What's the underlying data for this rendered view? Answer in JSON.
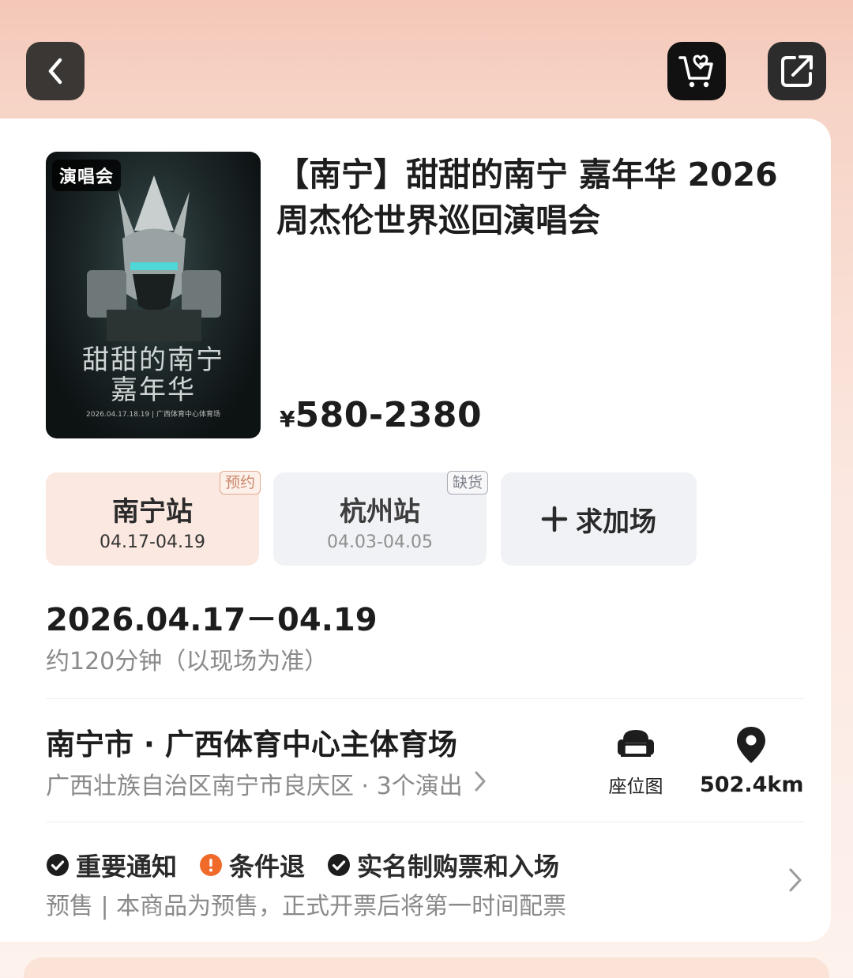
{
  "header": {
    "back_icon": "chevron-left-icon",
    "wishlist_icon": "cart-heart-icon",
    "share_icon": "share-icon"
  },
  "poster": {
    "tag": "演唱会",
    "title_line1": "甜甜的南宁",
    "title_line2": "嘉年华",
    "subtitle": "2026.04.17.18.19 | 广西体育中心体育场"
  },
  "event": {
    "title": "【南宁】甜甜的南宁 嘉年华 2026 周杰伦世界巡回演唱会",
    "price_symbol": "¥",
    "price_range": "580-2380"
  },
  "sessions": [
    {
      "name": "南宁站",
      "date": "04.17-04.19",
      "badge": "预约",
      "selected": true
    },
    {
      "name": "杭州站",
      "date": "04.03-04.05",
      "badge": "缺货",
      "selected": false
    }
  ],
  "add_session": {
    "label": "求加场",
    "icon": "plus-icon"
  },
  "schedule": {
    "date_range": "2026.04.17－04.19",
    "duration": "约120分钟（以现场为准）"
  },
  "venue": {
    "name": "南宁市 · 广西体育中心主体育场",
    "address": "广西壮族自治区南宁市良庆区 · 3个演出",
    "seat_map_label": "座位图",
    "seat_map_icon": "armchair-icon",
    "distance": "502.4km",
    "distance_icon": "location-pin-icon"
  },
  "notices": {
    "items": [
      {
        "label": "重要通知",
        "icon": "check-circle-icon",
        "color": "#1d1d1d"
      },
      {
        "label": "条件退",
        "icon": "alert-circle-icon",
        "color": "#f06a2a"
      },
      {
        "label": "实名制购票和入场",
        "icon": "check-circle-icon",
        "color": "#1d1d1d"
      }
    ],
    "presale_text": "预售 | 本商品为预售，正式开票后将第一时间配票"
  },
  "colors": {
    "background_top": "#f4c7b8",
    "selected_session_bg": "#fbe9e1",
    "badge_text": "#c9876a",
    "warning": "#f06a2a"
  }
}
